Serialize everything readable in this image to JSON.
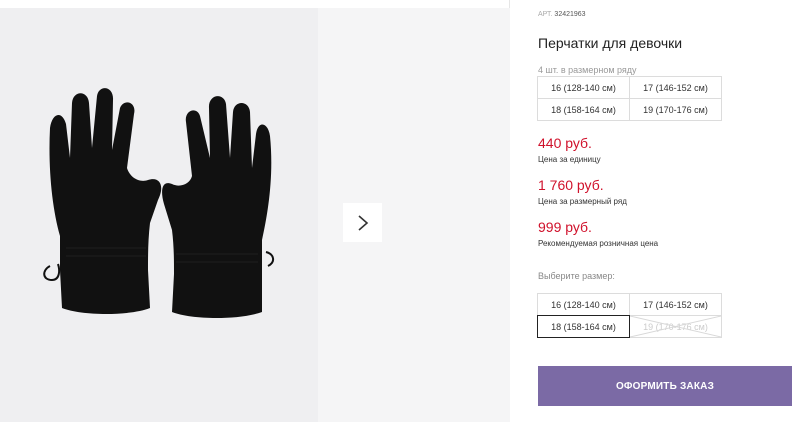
{
  "product": {
    "sku_label": "АРТ.",
    "sku": "32421963",
    "title": "Перчатки для девочки",
    "size_row_note": "4 шт. в размерном ряду",
    "size_row": [
      "16 (128-140 см)",
      "17 (146-152 см)",
      "18 (158-164 см)",
      "19 (170-176 см)"
    ]
  },
  "prices": [
    {
      "value": "440 руб.",
      "note": "Цена за единицу"
    },
    {
      "value": "1 760 руб.",
      "note": "Цена за размерный ряд"
    },
    {
      "value": "999 руб.",
      "note": "Рекомендуемая розничная цена"
    }
  ],
  "size_picker": {
    "label": "Выберите размер:",
    "options": [
      {
        "label": "16 (128-140 см)",
        "state": "available"
      },
      {
        "label": "17 (146-152 см)",
        "state": "available"
      },
      {
        "label": "18 (158-164 см)",
        "state": "selected"
      },
      {
        "label": "19 (170-176 см)",
        "state": "disabled"
      }
    ]
  },
  "order_button": "ОФОРМИТЬ ЗАКАЗ",
  "gallery": {
    "next_icon": "chevron-right-icon",
    "image": "black-fleece-gloves"
  },
  "colors": {
    "price": "#d0112b",
    "order_button": "#7b6aa5",
    "photo_bg": "#efeff1"
  }
}
